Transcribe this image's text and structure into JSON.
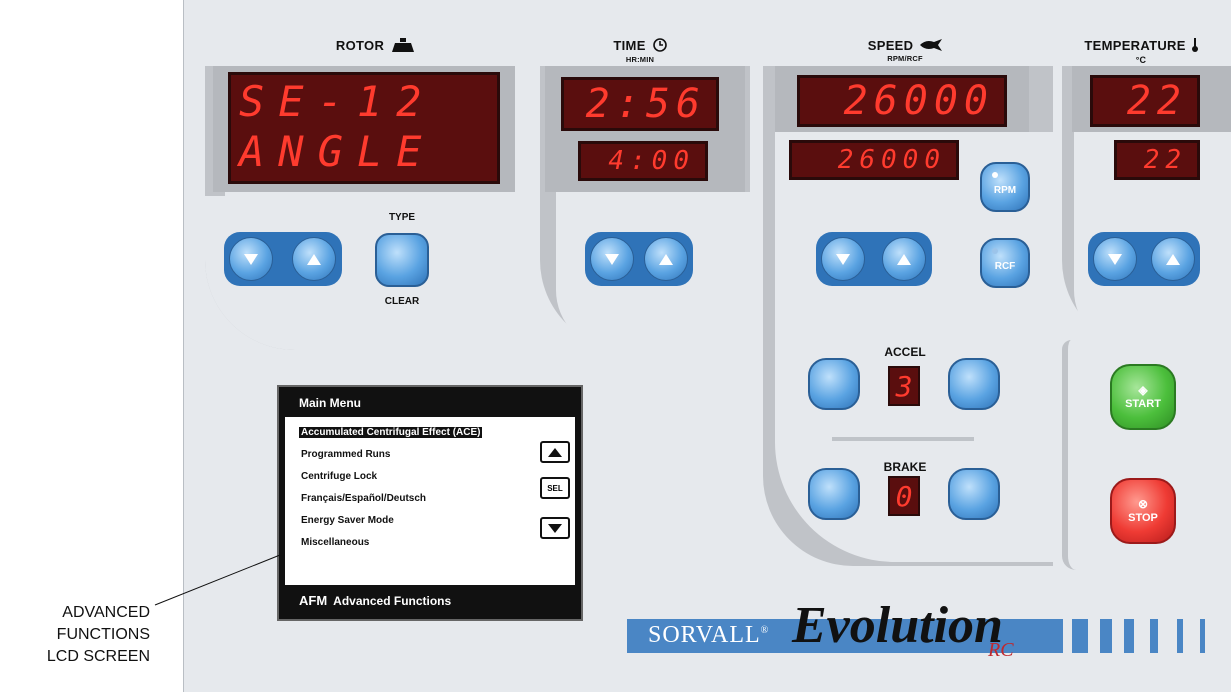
{
  "rotor": {
    "title": "ROTOR",
    "display_line1": "SE-12",
    "display_line2": "ANGLE",
    "type_label": "TYPE",
    "clear_label": "CLEAR"
  },
  "time": {
    "title": "TIME",
    "unit": "HR:MIN",
    "actual": "2:56",
    "set": "4:00"
  },
  "speed": {
    "title": "SPEED",
    "unit": "RPM/RCF",
    "actual": "26000",
    "set": "26000",
    "rpm_label": "RPM",
    "rcf_label": "RCF"
  },
  "temperature": {
    "title": "TEMPERATURE",
    "unit": "°C",
    "actual": "22",
    "set": "22"
  },
  "accel": {
    "label": "ACCEL",
    "value": "3"
  },
  "brake": {
    "label": "BRAKE",
    "value": "0"
  },
  "start_label": "START",
  "stop_label": "STOP",
  "lcd": {
    "title": "Main Menu",
    "items": [
      "Accumulated Centrifugal Effect (ACE)",
      "Programmed Runs",
      "Centrifuge Lock",
      "Français/Español/Deutsch",
      "Energy Saver Mode",
      "Miscellaneous"
    ],
    "selected_index": 0,
    "sel_label": "SEL",
    "footer_badge": "AFM",
    "footer_text": "Advanced Functions"
  },
  "brand": {
    "name": "SORVALL",
    "reg": "®",
    "model": "Evolution",
    "suffix": "RC"
  },
  "callout": {
    "line1": "ADVANCED",
    "line2": "FUNCTIONS",
    "line3": "LCD SCREEN"
  },
  "colors": {
    "led_bg": "#5a0e0e",
    "led_text": "#ff3b2e",
    "button_blue": "#2f73b8",
    "start_green": "#3aa63a",
    "stop_red": "#e02a2a",
    "brand_blue": "#4a86c5"
  }
}
